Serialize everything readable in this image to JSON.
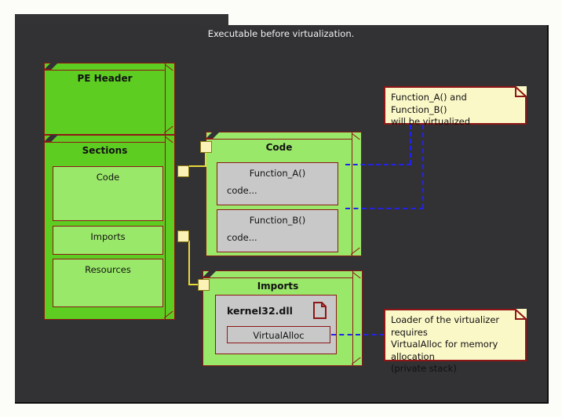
{
  "window": {
    "title": "Executable before virtualization."
  },
  "boxes": {
    "pe_header": {
      "label": "PE Header"
    },
    "sections": {
      "label": "Sections",
      "items": [
        {
          "label": "Code"
        },
        {
          "label": "Imports"
        },
        {
          "label": "Resources"
        }
      ]
    },
    "code": {
      "label": "Code",
      "functions": [
        {
          "name": "Function_A()",
          "body": "code..."
        },
        {
          "name": "Function_B()",
          "body": "code..."
        }
      ]
    },
    "imports": {
      "label": "Imports",
      "dll": {
        "name": "kernel32.dll",
        "icon": "document-icon"
      },
      "functions": [
        {
          "name": "VirtualAlloc"
        }
      ]
    }
  },
  "notes": [
    {
      "text": "Function_A() and Function_B()\nwill be virtualized"
    },
    {
      "text": "Loader of the virtualizer requires\nVirtualAlloc for memory allocation\n(private stack)"
    }
  ],
  "colors": {
    "canvas": "#323134",
    "box_fill_dark": "#5ecd22",
    "box_fill_light": "#9ae86a",
    "box_border": "#8e1616",
    "inner_fill": "#c8c8c8",
    "note_fill": "#fbf8c8",
    "connector_yellow": "#e8d93a",
    "dependency_blue": "#2222ee",
    "title_text": "#f2f2f2"
  }
}
